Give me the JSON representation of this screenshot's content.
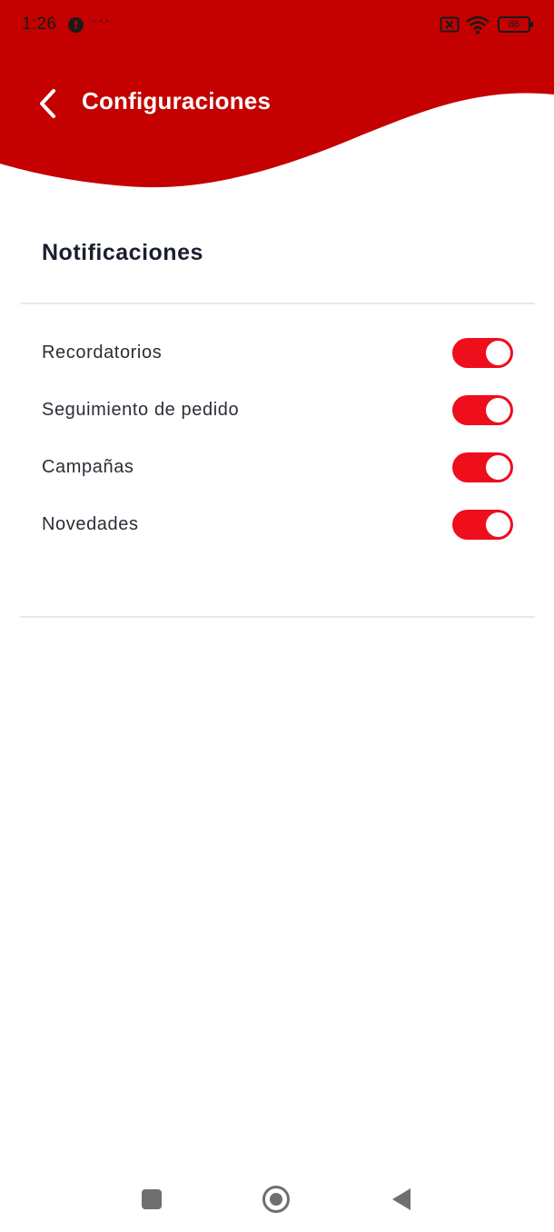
{
  "status_bar": {
    "time": "1:26",
    "more_dots": "···",
    "battery_level": "86",
    "icons": [
      "facebook-icon",
      "sim-disabled-icon",
      "wifi-icon",
      "battery-icon"
    ]
  },
  "header": {
    "title": "Configuraciones",
    "back_icon": "chevron-left-icon",
    "background_color": "#c40000"
  },
  "notifications": {
    "section_title": "Notificaciones",
    "items": [
      {
        "label": "Recordatorios",
        "enabled": true
      },
      {
        "label": "Seguimiento de pedido",
        "enabled": true
      },
      {
        "label": "Campañas",
        "enabled": true
      },
      {
        "label": "Novedades",
        "enabled": true
      }
    ],
    "toggle_on_color": "#ee0e1c"
  },
  "system_nav": {
    "icons": [
      "recent-apps-icon",
      "home-icon",
      "back-icon"
    ]
  }
}
